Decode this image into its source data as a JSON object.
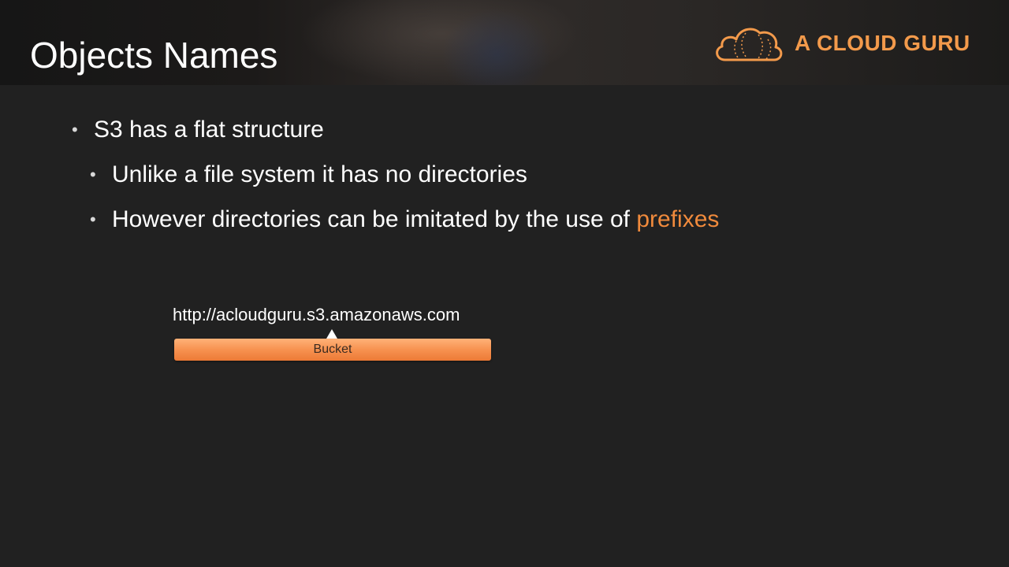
{
  "slide": {
    "title": "Objects Names"
  },
  "logo": {
    "text": "A CLOUD GURU",
    "icon": "cloud-icon",
    "color": "#f39a4b"
  },
  "bullets": {
    "level1": {
      "text": "S3 has a flat structure"
    },
    "level2a": {
      "text": "Unlike a file system it has no directories"
    },
    "level2b": {
      "text_before": "However directories can be imitated by the use of ",
      "highlight": "prefixes"
    },
    "bullet_symbol": "•"
  },
  "diagram": {
    "url": "http://acloudguru.s3.amazonaws.com",
    "bucket_label": "Bucket"
  },
  "colors": {
    "background": "#212121",
    "accent": "#f08a3c",
    "text": "#ffffff"
  }
}
